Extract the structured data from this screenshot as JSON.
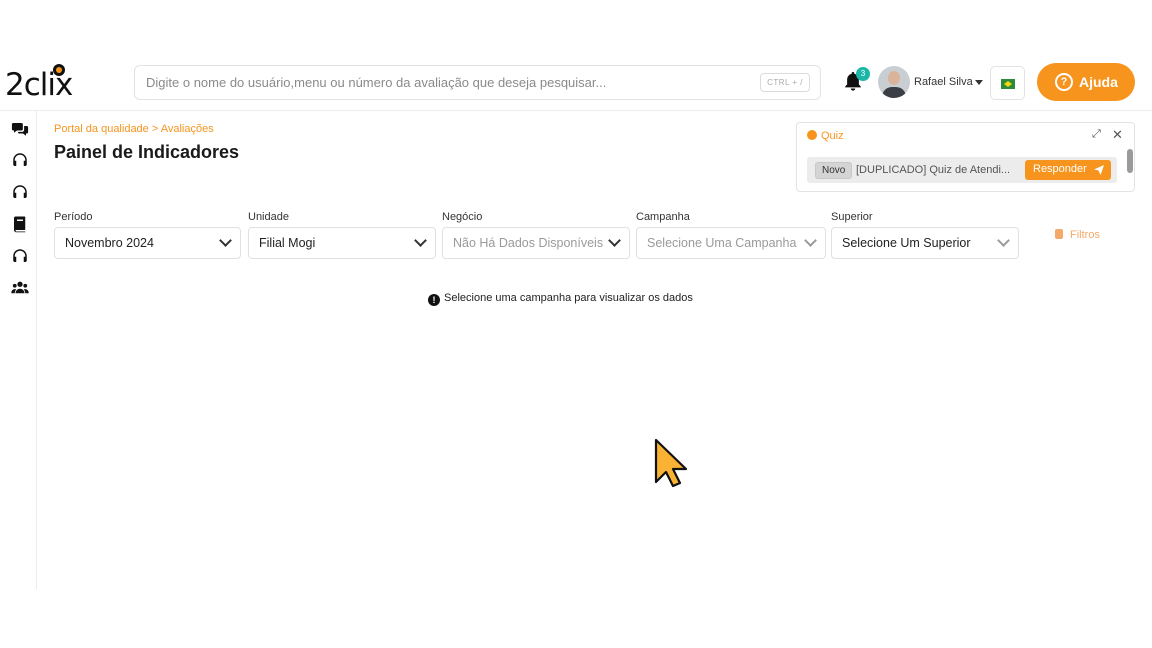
{
  "header": {
    "logo_text": "2clix",
    "search": {
      "placeholder": "Digite o nome do usuário,menu ou número da avaliação que deseja pesquisar...",
      "shortcut": "CTRL + /"
    },
    "notifications_count": "3",
    "user_name": "Rafael Silva",
    "help_label": "Ajuda",
    "help_icon_glyph": "?"
  },
  "sidebar": {
    "icons": [
      "chat-icon",
      "headset-icon",
      "headset-icon",
      "book-icon",
      "headset-icon",
      "users-icon"
    ]
  },
  "main": {
    "breadcrumb": "Portal da qualidade > Avaliações",
    "title": "Painel de Indicadores",
    "quiz": {
      "title": "Quiz",
      "badge": "Novo",
      "text": "[DUPLICADO] Quiz de Atendi...",
      "answer_label": "Responder"
    },
    "filters": [
      {
        "label": "Período",
        "value": "Novembro 2024",
        "muted": false
      },
      {
        "label": "Unidade",
        "value": "Filial Mogi",
        "muted": false
      },
      {
        "label": "Negócio",
        "value": "Não Há Dados Disponíveis",
        "muted": true
      },
      {
        "label": "Campanha",
        "value": "Selecione Uma Campanha",
        "muted": true
      },
      {
        "label": "Superior",
        "value": "Selecione Um Superior",
        "muted": false
      }
    ],
    "filters_button": "Filtros",
    "empty_message": "Selecione uma campanha para visualizar os dados",
    "empty_icon_glyph": "!"
  },
  "colors": {
    "accent": "#f7941d",
    "badge": "#1ab7a9"
  }
}
